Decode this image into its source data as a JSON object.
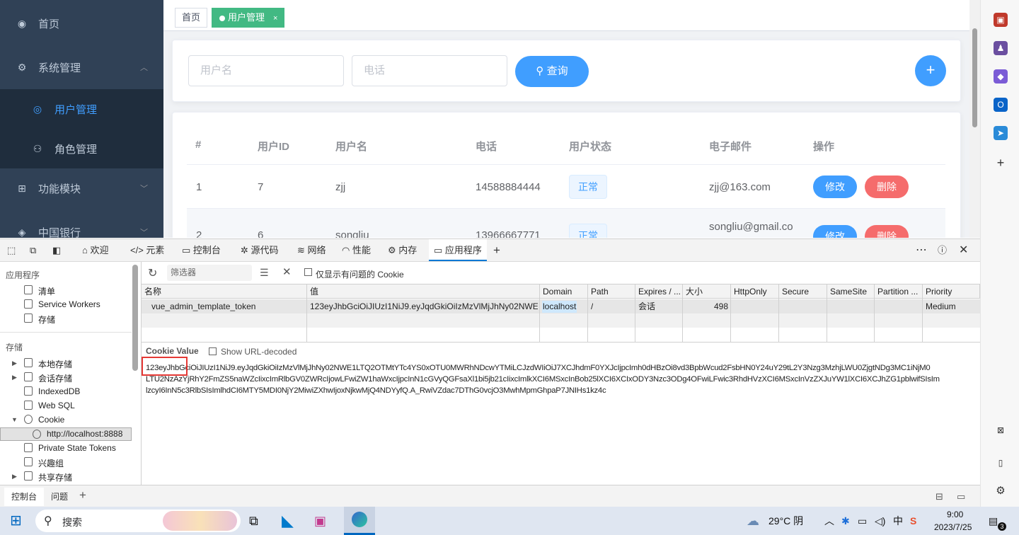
{
  "sidebar": {
    "items": [
      {
        "icon": "dashboard-icon",
        "label": "首页"
      },
      {
        "icon": "system-icon",
        "label": "系统管理"
      },
      {
        "icon": "user-icon",
        "label": "用户管理"
      },
      {
        "icon": "role-icon",
        "label": "角色管理"
      },
      {
        "icon": "module-icon",
        "label": "功能模块"
      },
      {
        "icon": "bank-icon",
        "label": "中国银行"
      }
    ]
  },
  "tags": {
    "home": "首页",
    "current": "用户管理",
    "close": "×"
  },
  "search": {
    "username_placeholder": "用户名",
    "phone_placeholder": "电话",
    "query_label": "查询",
    "add_label": "+"
  },
  "table": {
    "headers": [
      "#",
      "用户ID",
      "用户名",
      "电话",
      "用户状态",
      "电子邮件",
      "操作"
    ],
    "rows": [
      {
        "idx": "1",
        "id": "7",
        "name": "zjj",
        "phone": "14588884444",
        "status": "正常",
        "email": "zjj@163.com",
        "edit": "修改",
        "delete": "删除"
      },
      {
        "idx": "2",
        "id": "6",
        "name": "songliu",
        "phone": "13966667771",
        "status": "正常",
        "email": "songliu@gmail.co",
        "edit": "修改",
        "delete": "删除"
      }
    ]
  },
  "devtools": {
    "tabs": [
      "欢迎",
      "元素",
      "控制台",
      "源代码",
      "网络",
      "性能",
      "内存",
      "应用程序"
    ],
    "app_section": "应用程序",
    "app_items": [
      "清单",
      "Service Workers",
      "存储"
    ],
    "storage_section": "存储",
    "storage_items": [
      "本地存储",
      "会话存储",
      "IndexedDB",
      "Web SQL",
      "Cookie",
      "http://localhost:8888",
      "Private State Tokens",
      "兴趣组",
      "共享存储"
    ],
    "filter_placeholder": "筛选器",
    "only_issues": "仅显示有问题的 Cookie",
    "columns": [
      "名称",
      "值",
      "Domain",
      "Path",
      "Expires / ...",
      "大小",
      "HttpOnly",
      "Secure",
      "SameSite",
      "Partition ...",
      "Priority"
    ],
    "cookie": {
      "name": "vue_admin_template_token",
      "value": "123eyJhbGciOiJIUzI1NiJ9.eyJqdGkiOiIzMzVlMjJhNy02NWE...",
      "domain": "localhost",
      "path": "/",
      "expires": "会话",
      "size": "498",
      "priority": "Medium"
    },
    "cookie_value_label": "Cookie Value",
    "show_decoded": "Show URL-decoded",
    "value_line1": "123eyJhbGciOiJIUzI1NiJ9.eyJqdGkiOiIzMzVlMjJhNy02NWE1LTQ2OTMtYTc4YS0xOTU0MWRhNDcwYTMiLCJzdWIiOiJ7XCJhdmF0YXJcIjpcImh0dHBzOi8vd3BpbWcud2FsbHN0Y24uY29tL2Y3Nzg3MzhjLWU0ZjgtNDg3MC1iNjM0",
    "value_line2": "LTU2NzAzYjRhY2FmZS5naWZcIixcImRlbGV0ZWRcIjowLFwiZW1haWxcIjpcInN1cGVyQGFsaXl1bi5jb21cIixcImlkXCI6MSxcInBob25lXCI6XCIxODY3Nzc3ODg4OFwiLFwic3RhdHVzXCI6MSxcInVzZXJuYW1lXCI6XCJhZG1pblwifSIsIm",
    "value_line3": "lzcyI6InN5c3RlbSIsImlhdCI6MTY5MDI0NjY2MiwiZXhwIjoxNjkwMjQ4NDYyfQ.A_RwiVZdac7DThG0vcjO3MwhMpmGhpaP7JNIHs1kz4c",
    "bottom_tabs": [
      "控制台",
      "问题"
    ]
  },
  "taskbar": {
    "search": "搜索",
    "weather": "29°C 阴",
    "ime": "中",
    "time": "9:00",
    "date": "2023/7/25",
    "notif": "3"
  }
}
